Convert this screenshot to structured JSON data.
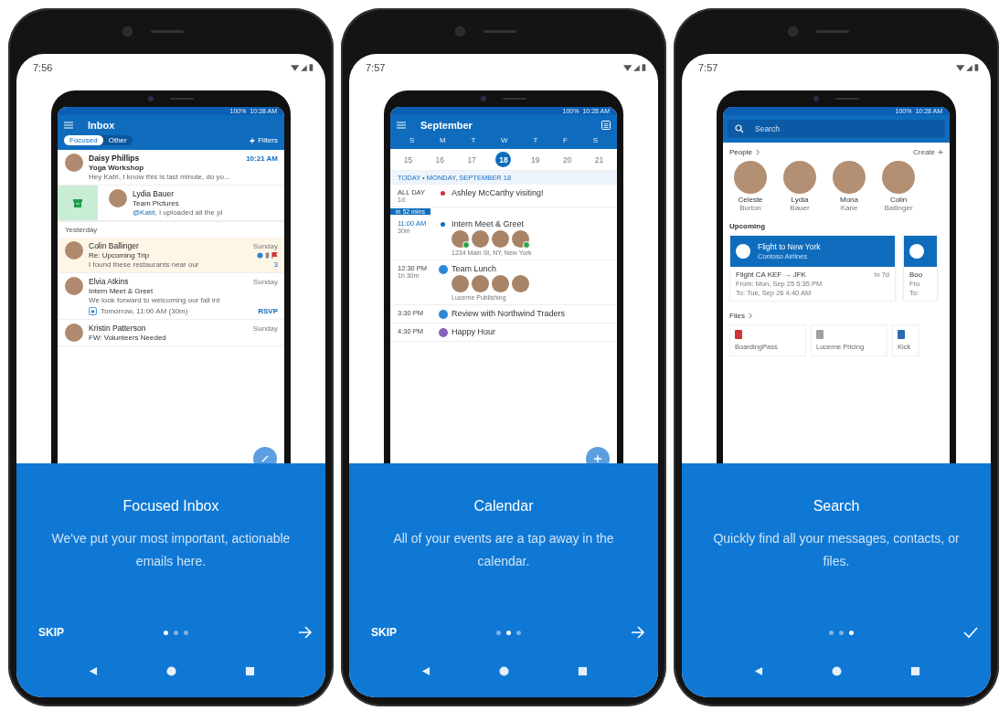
{
  "phones": [
    {
      "status_time": "7:56",
      "title": "Focused Inbox",
      "description": "We've put your most important, actionable emails here.",
      "skip": "SKIP",
      "next_button": {
        "kind": "arrow"
      },
      "pages": [
        {
          "selected": true
        },
        {
          "selected": false
        },
        {
          "selected": false
        }
      ],
      "mockup": {
        "kind": "inbox",
        "battery": "100%",
        "clock": "10:28 AM",
        "heading": "Inbox",
        "filters": "Filters",
        "tabs": [
          {
            "label": "Focused",
            "selected": true
          },
          {
            "label": "Other",
            "selected": false
          }
        ],
        "items": [
          {
            "kind": "message",
            "sender": "Daisy Phillips",
            "subject": "Yoga Workshop",
            "preview": "Hey Katri, I know this is last minute, do yo...",
            "time": "10:21 AM",
            "unread": true,
            "highlighted": false,
            "swiped": false,
            "flags": false
          },
          {
            "kind": "message",
            "sender": "Lydia Bauer",
            "subject": "Team Pictures",
            "mention": "@Katri,",
            "preview": " I uploaded all the pi",
            "unread": false,
            "highlighted": false,
            "swiped": true,
            "flags": false
          },
          {
            "kind": "section",
            "label": "Yesterday"
          },
          {
            "kind": "message",
            "sender": "Colin Ballinger",
            "subject": "Re: Upcoming Trip",
            "preview": "I found these restaurants near our",
            "time": "Sunday",
            "count": "3",
            "unread": false,
            "highlighted": true,
            "swiped": false,
            "flags": true
          },
          {
            "kind": "message",
            "sender": "Elvia Atkins",
            "subject": "Intern Meet & Greet",
            "preview": "We look forward to welcoming our fall int",
            "time": "Sunday",
            "event": "Tomorrow, 11:00 AM (30m)",
            "action": "RSVP",
            "unread": false,
            "highlighted": false,
            "swiped": false,
            "flags": false
          },
          {
            "kind": "message",
            "sender": "Kristin Patterson",
            "subject": "FW: Volunteers Needed",
            "time": "Sunday",
            "unread": false,
            "highlighted": false,
            "swiped": false,
            "flags": false
          }
        ]
      }
    },
    {
      "status_time": "7:57",
      "title": "Calendar",
      "description": "All of your events are a tap away in the calendar.",
      "skip": "SKIP",
      "next_button": {
        "kind": "arrow"
      },
      "pages": [
        {
          "selected": false
        },
        {
          "selected": true
        },
        {
          "selected": false
        }
      ],
      "mockup": {
        "kind": "calendar",
        "battery": "100%",
        "clock": "10:28 AM",
        "heading": "September",
        "weekdays": [
          "S",
          "M",
          "T",
          "W",
          "T",
          "F",
          "S"
        ],
        "dates": [
          {
            "label": "15",
            "selected": false
          },
          {
            "label": "16",
            "selected": false
          },
          {
            "label": "17",
            "selected": false
          },
          {
            "label": "18",
            "selected": true
          },
          {
            "label": "19",
            "selected": false
          },
          {
            "label": "20",
            "selected": false
          },
          {
            "label": "21",
            "selected": false
          }
        ],
        "agenda_header": "TODAY • MONDAY, SEPTEMBER 18",
        "events": [
          {
            "marker": {
              "kind": "dot"
            },
            "color": "#d13438",
            "time": "ALL DAY",
            "duration": "1d",
            "title": "Ashley McCarthy visiting!",
            "current": false
          },
          {
            "marker": {
              "kind": "dot"
            },
            "color": "#0f6cbd",
            "time": "11:00 AM",
            "duration": "30m",
            "title": "Intern Meet & Greet",
            "badge": "in 52 mins",
            "attendees": [
              {
                "accepted": true
              },
              {
                "accepted": false
              },
              {
                "accepted": false
              },
              {
                "accepted": true
              }
            ],
            "location": "1234 Main St, NY, New York",
            "current": true
          },
          {
            "marker": {
              "kind": "icon"
            },
            "color": "#2b88d8",
            "time": "12:30 PM",
            "duration": "1h 30m",
            "title": "Team Lunch",
            "attendees": [
              {
                "accepted": false
              },
              {
                "accepted": false
              },
              {
                "accepted": false
              },
              {
                "accepted": false
              }
            ],
            "location": "Lucerne Publishing",
            "current": false
          },
          {
            "marker": {
              "kind": "icon"
            },
            "color": "#2b88d8",
            "time": "3:30 PM",
            "title": "Review with Northwind Traders",
            "current": false
          },
          {
            "marker": {
              "kind": "icon"
            },
            "color": "#8764b8",
            "time": "4:30 PM",
            "title": "Happy Hour",
            "current": false
          }
        ]
      }
    },
    {
      "status_time": "7:57",
      "title": "Search",
      "description": "Quickly find all your messages, contacts, or files.",
      "next_button": {
        "kind": "check"
      },
      "pages": [
        {
          "selected": false
        },
        {
          "selected": false
        },
        {
          "selected": true
        }
      ],
      "mockup": {
        "kind": "search",
        "battery": "100%",
        "clock": "10:28 AM",
        "placeholder": "Search",
        "people_label": "People",
        "create_label": "Create",
        "people": [
          {
            "first": "Celeste",
            "last": "Burton"
          },
          {
            "first": "Lydia",
            "last": "Bauer"
          },
          {
            "first": "Mona",
            "last": "Kane"
          },
          {
            "first": "Colin",
            "last": "Ballinger"
          }
        ],
        "upcoming_label": "Upcoming",
        "cards": [
          {
            "title": "Flight to New York",
            "subtitle": "Contoso Airlines",
            "line": "Flight CA KEF → JFK",
            "due": "In 7d",
            "from": "From: Mon, Sep 25 5:35 PM",
            "to": "To: Tue, Sep 26 4:40 AM"
          },
          {
            "line": "Boo",
            "from": "Fro",
            "to": "To:"
          }
        ],
        "files_label": "Files",
        "files": [
          {
            "name": "BoardingPass",
            "color": "#d13438"
          },
          {
            "name": "Lucerne Pricing",
            "color": "#a0a0a0"
          },
          {
            "name": "Kick",
            "color": "#2b6cb0"
          }
        ]
      }
    }
  ]
}
